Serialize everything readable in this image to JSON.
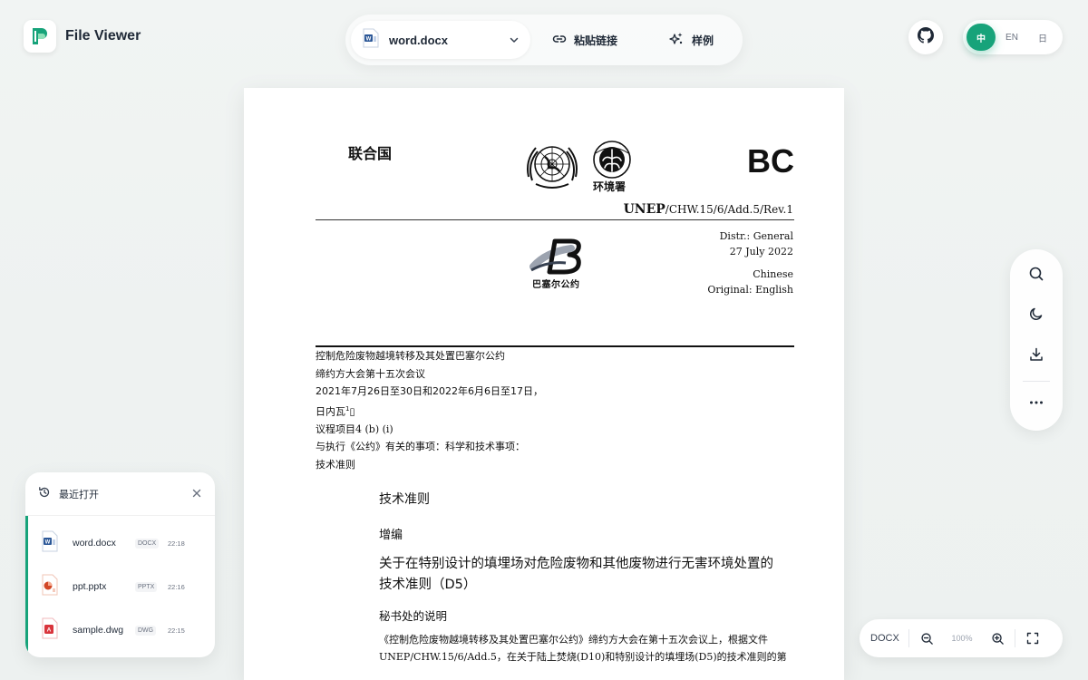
{
  "app": {
    "name": "File Viewer"
  },
  "toolbar": {
    "file_select": {
      "value": "word.docx"
    },
    "paste_label": "粘贴链接",
    "sample_label": "样例"
  },
  "language": {
    "options": [
      "中",
      "EN",
      "日"
    ],
    "active": "中"
  },
  "document": {
    "header": {
      "org_zh": "联合国",
      "unep_zh": "环境署",
      "code": "BC",
      "symbol_prefix": "UNEP",
      "symbol_rest": "/CHW.15/6/Add.5/Rev.1",
      "distr": "Distr.: General",
      "date": "27 July 2022",
      "lang": "Chinese",
      "original": "Original: English",
      "basel_zh": "巴塞尔公约"
    },
    "meta": {
      "line1": "控制危险废物越境转移及其处置巴塞尔公约",
      "line2": "缔约方大会第十五次会议",
      "line3": "2021年7月26日至30日和2022年6月6日至17日，日内瓦",
      "line3_sup": "1",
      "line3_mark": "▯",
      "line4": "议程项目4 (b) (i)",
      "line5": "与执行《公约》有关的事项：科学和技术事项：",
      "line6": "技术准则"
    },
    "title": "技术准则",
    "subtitle": "增编",
    "main_title": "关于在特别设计的填埋场对危险废物和其他废物进行无害环境处置的技术准则（D5）",
    "note_title": "秘书处的说明",
    "body": "《控制危险废物越境转移及其处置巴塞尔公约》缔约方大会在第十五次会议上，根据文件UNEP/CHW.15/6/Add.5，在关于陆上焚烧(D10)和特别设计的填埋场(D5)的技术准则的第"
  },
  "recent": {
    "title": "最近打开",
    "items": [
      {
        "name": "word.docx",
        "type": "DOCX",
        "time": "22:18"
      },
      {
        "name": "ppt.pptx",
        "type": "PPTX",
        "time": "22:16"
      },
      {
        "name": "sample.dwg",
        "type": "DWG",
        "time": "22:15"
      }
    ]
  },
  "zoom": {
    "format": "DOCX",
    "level": "100%"
  },
  "colors": {
    "accent": "#17a37a",
    "word": "#2b5797",
    "ppt": "#d24726",
    "dwg": "#d9343c"
  }
}
